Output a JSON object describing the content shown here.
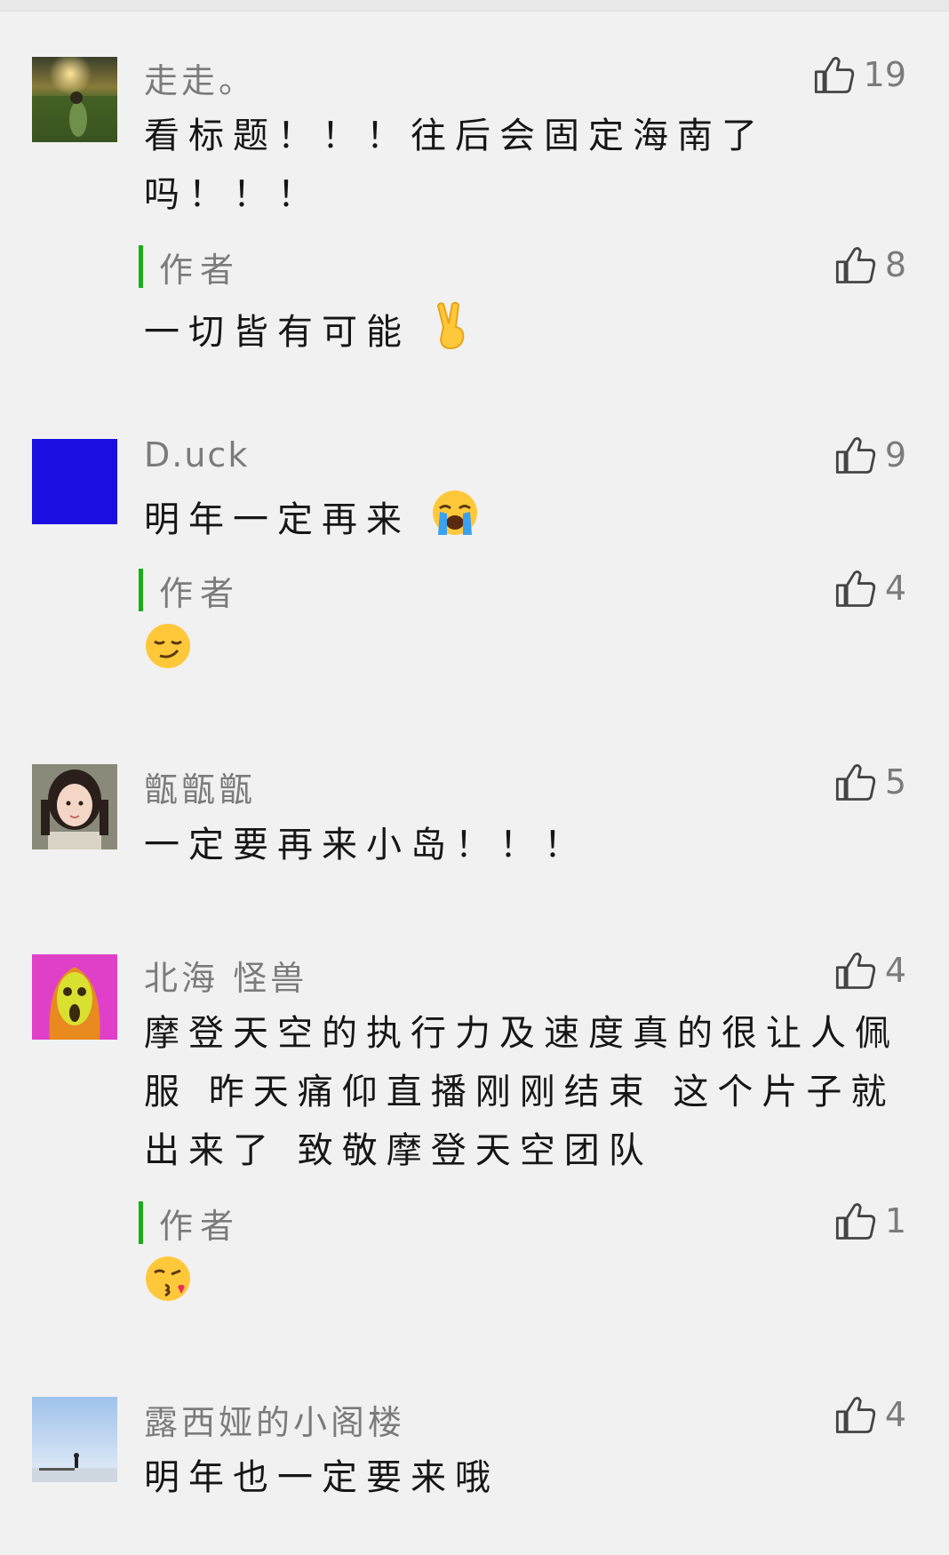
{
  "colors": {
    "author_bar": "#1aad19",
    "muted_text": "#7b7b7b",
    "content_text": "#161616",
    "background": "#f1f1f1"
  },
  "comments": [
    {
      "nickname": "走走。",
      "likes": "19",
      "text": "看标题！！！往后会固定海南了吗！！！",
      "reply": {
        "label": "作者",
        "likes": "8",
        "text": "一切皆有可能",
        "emoji": "victory-hand-emoji"
      }
    },
    {
      "nickname": "D.uck",
      "likes": "9",
      "text": "明年一定再来",
      "emoji": "loudly-crying-face-emoji",
      "reply": {
        "label": "作者",
        "likes": "4",
        "text": "",
        "emoji": "smirking-face-emoji"
      }
    },
    {
      "nickname": "甑甑甑",
      "likes": "5",
      "text": "一定要再来小岛！！！"
    },
    {
      "nickname": "北海 怪兽",
      "likes": "4",
      "text": "摩登天空的执行力及速度真的很让人佩服 昨天痛仰直播刚刚结束 这个片子就出来了 致敬摩登天空团队",
      "reply": {
        "label": "作者",
        "likes": "1",
        "text": "",
        "emoji": "face-blowing-kiss-emoji"
      }
    },
    {
      "nickname": "露西娅的小阁楼",
      "likes": "4",
      "text": "明年也一定要来哦"
    }
  ]
}
